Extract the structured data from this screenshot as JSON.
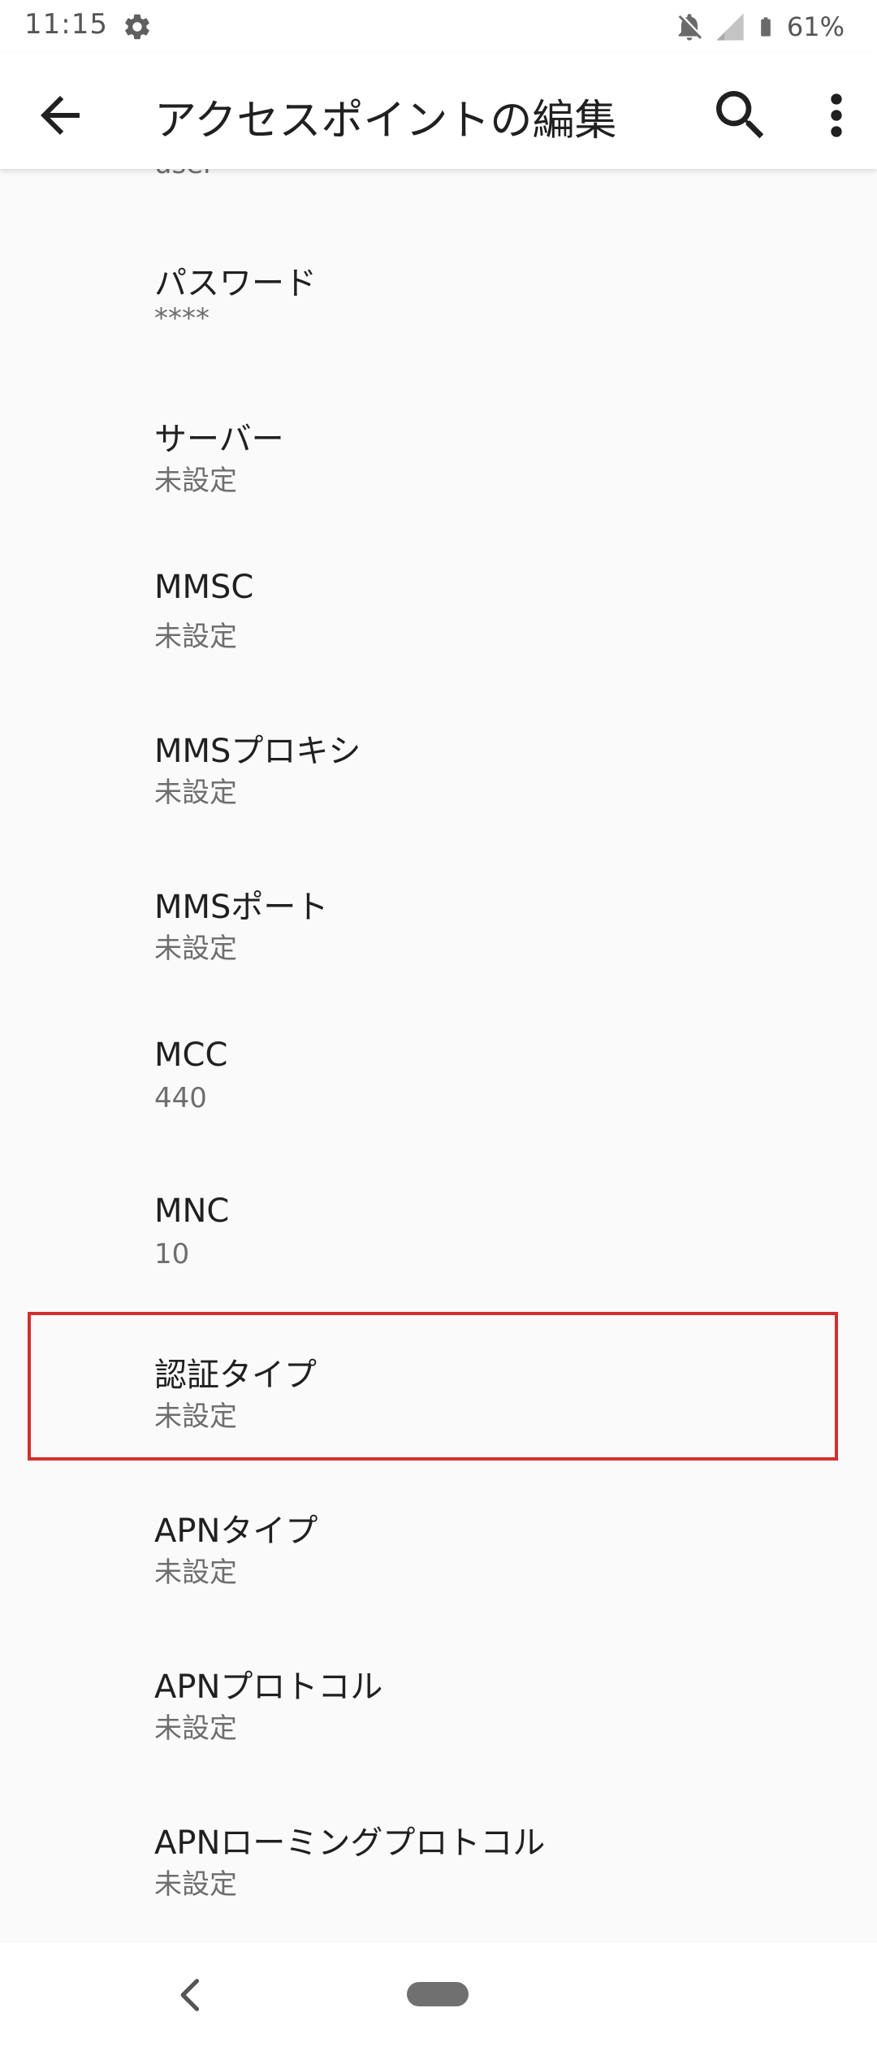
{
  "status_bar": {
    "time": "11:15",
    "battery": "61%",
    "icons": [
      "settings-icon",
      "notifications-off-icon",
      "signal-icon",
      "battery-icon"
    ]
  },
  "app_bar": {
    "title": "アクセスポイントの編集",
    "icons": [
      "back-arrow-icon",
      "search-icon",
      "more-vert-icon"
    ]
  },
  "list": {
    "peek_summary": "user",
    "items": [
      {
        "title": "パスワード",
        "summary": "****"
      },
      {
        "title": "サーバー",
        "summary": "未設定"
      },
      {
        "title": "MMSC",
        "summary": "未設定"
      },
      {
        "title": "MMSプロキシ",
        "summary": "未設定"
      },
      {
        "title": "MMSポート",
        "summary": "未設定"
      },
      {
        "title": "MCC",
        "summary": "440"
      },
      {
        "title": "MNC",
        "summary": "10"
      },
      {
        "title": "認証タイプ",
        "summary": "未設定"
      },
      {
        "title": "APNタイプ",
        "summary": "未設定"
      },
      {
        "title": "APNプロトコル",
        "summary": "未設定"
      },
      {
        "title": "APNローミングプロトコル",
        "summary": "未設定"
      }
    ]
  },
  "highlight_color": "#d32f2f",
  "nav_bar": {
    "icons": [
      "nav-back-icon",
      "home-pill-icon"
    ]
  }
}
